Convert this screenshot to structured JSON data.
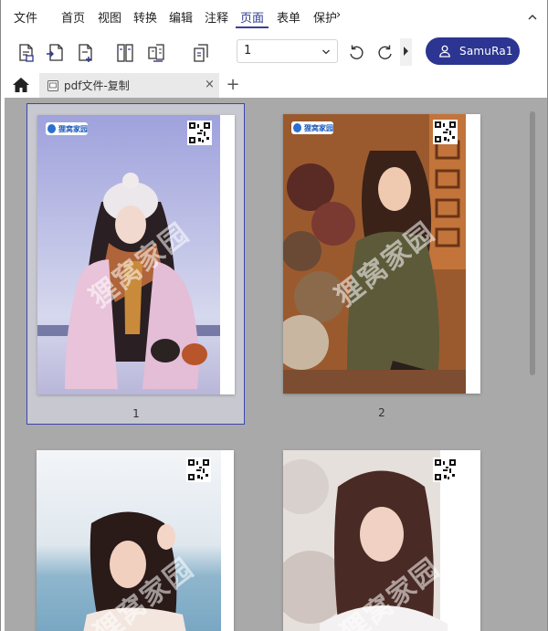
{
  "menu": {
    "items": [
      "文件",
      "首页",
      "视图",
      "转换",
      "编辑",
      "注释",
      "页面",
      "表单",
      "保护"
    ],
    "active_index": 6,
    "more_glyph": "›"
  },
  "toolbar": {
    "page_select_value": "1",
    "user_name": "SamuRa1",
    "icons": [
      "extract-page-icon",
      "insert-page-icon",
      "add-blank-page-icon",
      "split-page-icon",
      "replace-page-icon",
      "crop-page-icon",
      "rotate-left-icon",
      "rotate-right-icon"
    ]
  },
  "tabs": {
    "document_title": "pdf文件-复制",
    "close_glyph": "×",
    "add_glyph": "+"
  },
  "pages": [
    {
      "number": "1",
      "selected": true
    },
    {
      "number": "2",
      "selected": false
    },
    {
      "number": "",
      "selected": false
    },
    {
      "number": "",
      "selected": false
    }
  ],
  "watermark": {
    "logo_text": "狸窝家园",
    "overlay_text": "狸窝家园"
  },
  "colors": {
    "accent": "#2c3591",
    "content_bg": "#a9a9a9",
    "selection_border": "#3b46b0"
  }
}
